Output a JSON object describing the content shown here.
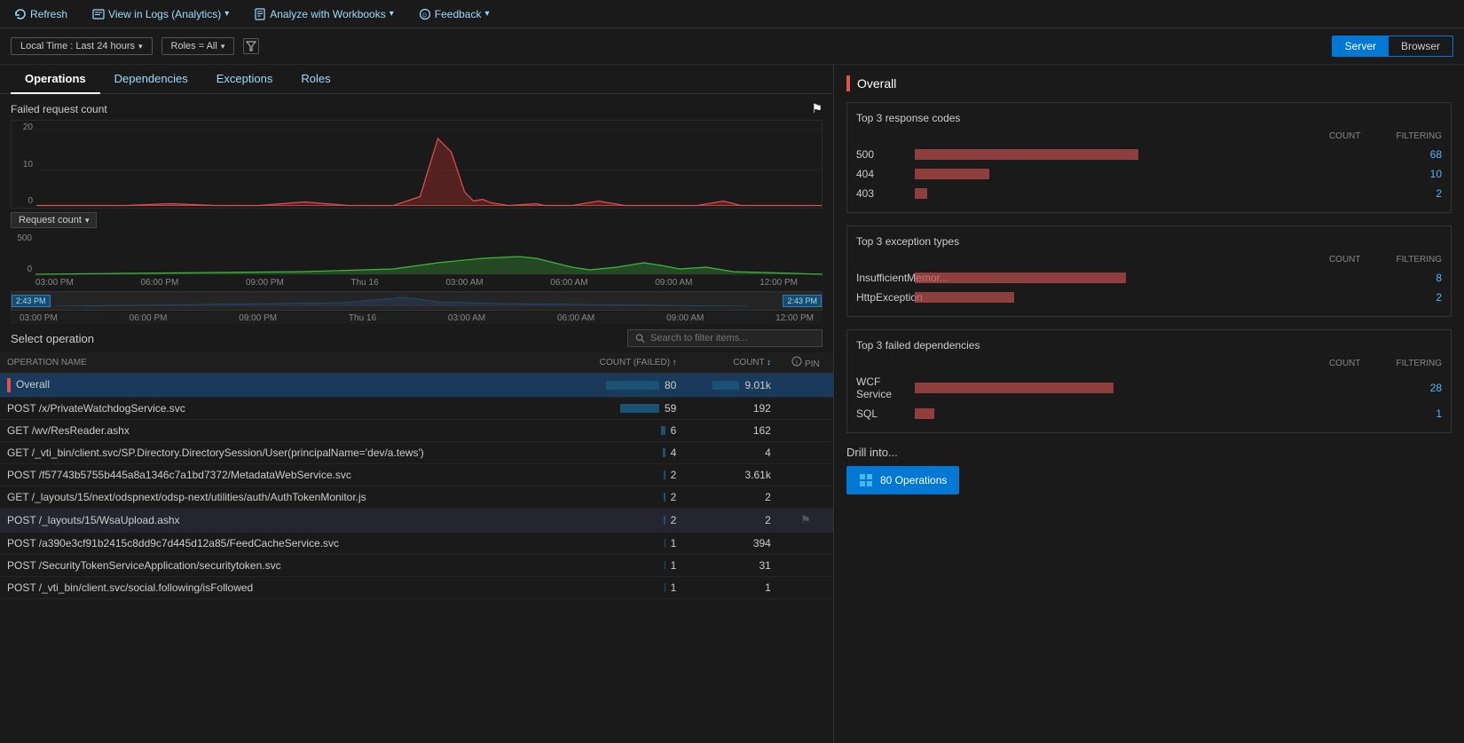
{
  "toolbar": {
    "refresh_label": "Refresh",
    "view_logs_label": "View in Logs (Analytics)",
    "analyze_label": "Analyze with Workbooks",
    "feedback_label": "Feedback"
  },
  "filter_bar": {
    "time_filter": "Local Time : Last 24 hours",
    "roles_filter": "Roles = All",
    "server_label": "Server",
    "browser_label": "Browser"
  },
  "tabs": [
    "Operations",
    "Dependencies",
    "Exceptions",
    "Roles"
  ],
  "active_tab": "Operations",
  "chart": {
    "title": "Failed request count",
    "y_labels": [
      "20",
      "10",
      "0"
    ],
    "time_labels": [
      "03:00 PM",
      "06:00 PM",
      "09:00 PM",
      "Thu 16",
      "03:00 AM",
      "06:00 AM",
      "09:00 AM",
      "12:00 PM"
    ],
    "range_start": "2:43 PM",
    "range_end": "2:43 PM"
  },
  "second_chart": {
    "dropdown_label": "Request count",
    "y_labels": [
      "500",
      "0"
    ]
  },
  "operations": {
    "title": "Select operation",
    "search_placeholder": "Search to filter items...",
    "columns": {
      "name": "OPERATION NAME",
      "count_failed": "COUNT (FAILED)",
      "count": "COUNT",
      "pin": "PIN"
    },
    "rows": [
      {
        "name": "Overall",
        "count_failed": "80",
        "count": "9.01k",
        "selected": true,
        "indicator_color": "#e05252"
      },
      {
        "name": "POST /x/PrivateWatchdogService.svc",
        "count_failed": "59",
        "count": "192",
        "selected": false
      },
      {
        "name": "GET /wv/ResReader.ashx",
        "count_failed": "6",
        "count": "162",
        "selected": false
      },
      {
        "name": "GET /_vti_bin/client.svc/SP.Directory.DirectorySession/User(principalName='dev/a.tews')",
        "count_failed": "4",
        "count": "4",
        "selected": false
      },
      {
        "name": "POST /f57743b5755b445a8a1346c7a1bd7372/MetadataWebService.svc",
        "count_failed": "2",
        "count": "3.61k",
        "selected": false
      },
      {
        "name": "GET /_layouts/15/next/odspnext/odsp-next/utilities/auth/AuthTokenMonitor.js",
        "count_failed": "2",
        "count": "2",
        "selected": false
      },
      {
        "name": "POST /_layouts/15/WsaUpload.ashx",
        "count_failed": "2",
        "count": "2",
        "selected": false,
        "highlighted": true
      },
      {
        "name": "POST /a390e3cf91b2415c8dd9c7d445d12a85/FeedCacheService.svc",
        "count_failed": "1",
        "count": "394",
        "selected": false
      },
      {
        "name": "POST /SecurityTokenServiceApplication/securitytoken.svc",
        "count_failed": "1",
        "count": "31",
        "selected": false
      },
      {
        "name": "POST /_vti_bin/client.svc/social.following/isFollowed",
        "count_failed": "1",
        "count": "1",
        "selected": false
      }
    ]
  },
  "right_panel": {
    "overall_label": "Overall",
    "response_codes": {
      "title": "Top 3 response codes",
      "col_count": "COUNT",
      "col_filtering": "FILTERING",
      "rows": [
        {
          "code": "500",
          "bar_pct": 90,
          "count": "68",
          "filtering": ""
        },
        {
          "code": "404",
          "bar_pct": 30,
          "count": "10",
          "filtering": ""
        },
        {
          "code": "403",
          "bar_pct": 5,
          "count": "2",
          "filtering": ""
        }
      ]
    },
    "exception_types": {
      "title": "Top 3 exception types",
      "col_count": "COUNT",
      "col_filtering": "FILTERING",
      "rows": [
        {
          "type": "InsufficientMemor...",
          "bar_pct": 85,
          "count": "8",
          "filtering": ""
        },
        {
          "type": "HttpException",
          "bar_pct": 40,
          "count": "2",
          "filtering": ""
        }
      ]
    },
    "failed_dependencies": {
      "title": "Top 3 failed dependencies",
      "col_count": "COUNT",
      "col_filtering": "FILTERING",
      "rows": [
        {
          "type": "WCF Service",
          "bar_pct": 80,
          "count": "28",
          "filtering": ""
        },
        {
          "type": "SQL",
          "bar_pct": 8,
          "count": "1",
          "filtering": ""
        }
      ]
    },
    "drill_into": {
      "title": "Drill into...",
      "button_label": "80 Operations"
    }
  }
}
